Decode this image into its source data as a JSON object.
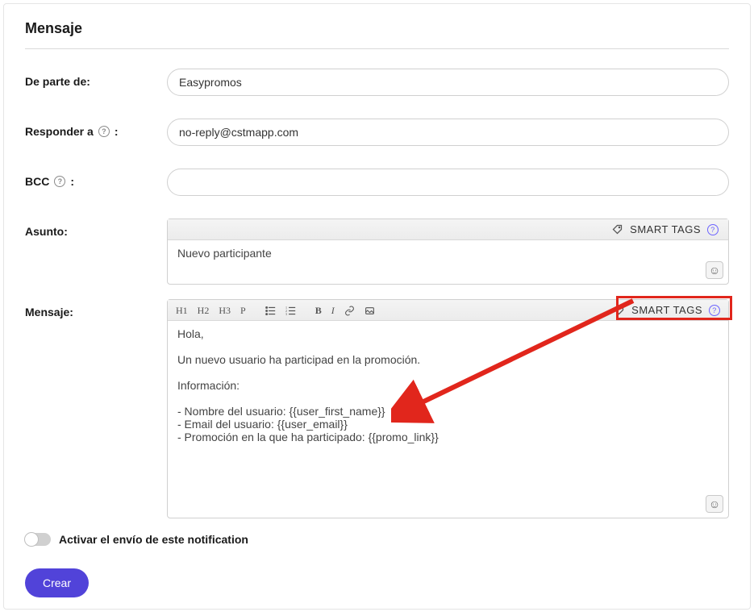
{
  "section_title": "Mensaje",
  "labels": {
    "from": "De parte de:",
    "reply_to": "Responder a",
    "reply_to_colon": ":",
    "bcc": "BCC",
    "bcc_colon": ":",
    "subject": "Asunto:",
    "message": "Mensaje:"
  },
  "fields": {
    "from_value": "Easypromos",
    "reply_to_value": "no-reply@cstmapp.com",
    "bcc_value": "",
    "subject_value": "Nuevo participante"
  },
  "smart_tags_label": "SMART TAGS",
  "toolbar": {
    "h1": "H1",
    "h2": "H2",
    "h3": "H3",
    "p": "P",
    "bold": "B",
    "italic": "I"
  },
  "message_body": "Hola,\n\nUn nuevo usuario ha participad en la promoción.\n\nInformación:\n\n- Nombre del usuario: {{user_first_name}}\n- Email del usuario: {{user_email}}\n- Promoción en la que ha participado: {{promo_link}}",
  "toggle_label": "Activar el envío de este notification",
  "create_button": "Crear"
}
